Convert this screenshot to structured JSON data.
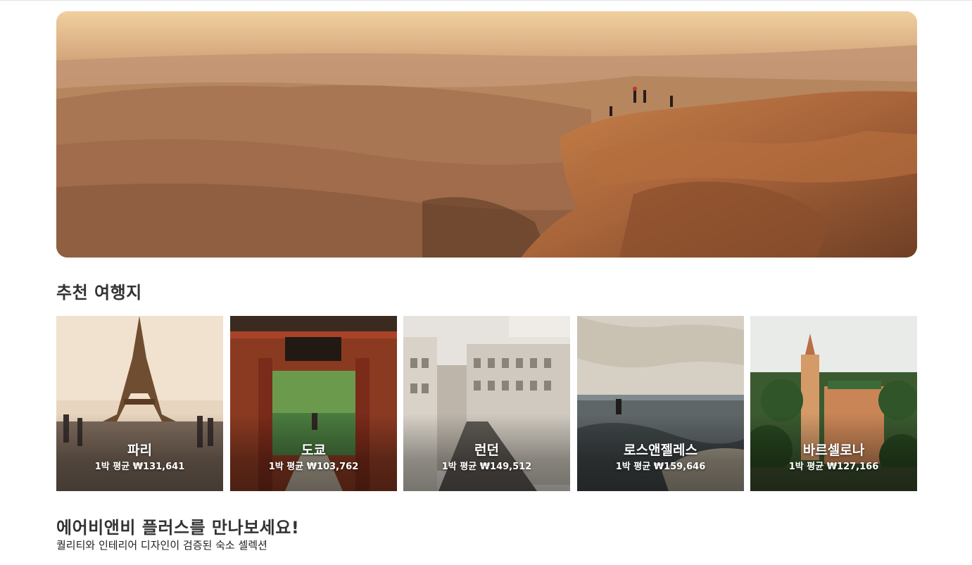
{
  "hero": {
    "image": "desert-canyon-landscape-photo"
  },
  "recommended": {
    "title": "추천 여행지",
    "cities": [
      {
        "name": "파리",
        "price": "1박 평균 ₩131,641",
        "image": "eiffel-tower-photo"
      },
      {
        "name": "도쿄",
        "price": "1박 평균 ₩103,762",
        "image": "temple-gate-photo"
      },
      {
        "name": "런던",
        "price": "1박 평균 ₩149,512",
        "image": "city-street-photo"
      },
      {
        "name": "로스앤젤레스",
        "price": "1박 평균 ₩159,646",
        "image": "skatepark-photo"
      },
      {
        "name": "바르셀로나",
        "price": "1박 평균 ₩127,166",
        "image": "palm-tower-photo"
      }
    ]
  },
  "plus": {
    "title": "에어비앤비 플러스를 만나보세요!",
    "subtitle": "퀄리티와 인테리어 디자인이 검증된 숙소 셀렉션"
  }
}
